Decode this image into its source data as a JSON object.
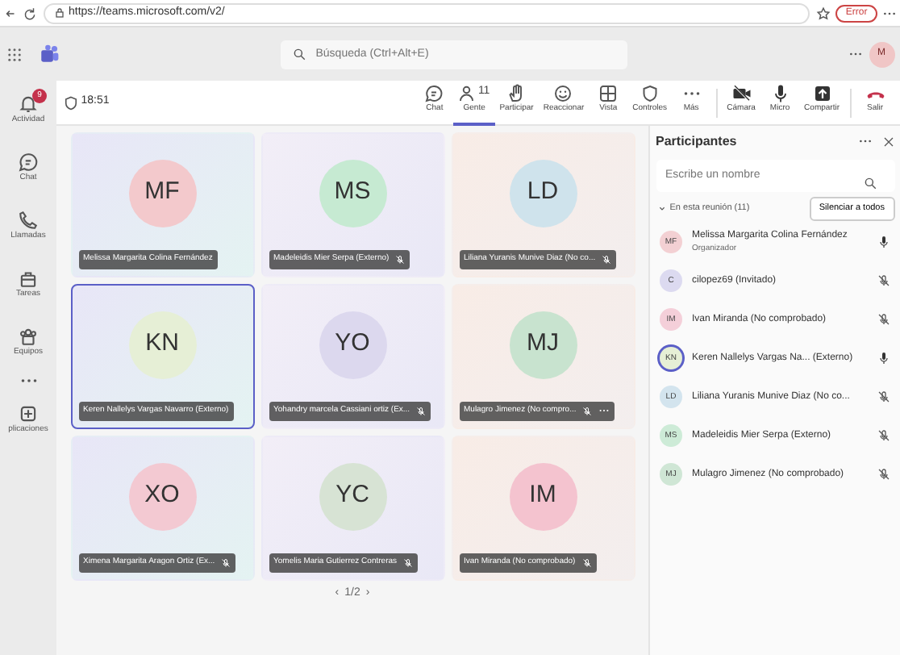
{
  "browser": {
    "url": "https://teams.microsoft.com/v2/",
    "error_label": "Error"
  },
  "header": {
    "search_placeholder": "Búsqueda (Ctrl+Alt+E)",
    "avatar": "M"
  },
  "rail": [
    {
      "label": "Actividad",
      "badge": "9",
      "selected": false
    },
    {
      "label": "Chat",
      "selected": false
    },
    {
      "label": "Llamadas",
      "selected": false
    },
    {
      "label": "Tareas",
      "selected": false
    },
    {
      "label": "Equipos",
      "selected": false
    },
    {
      "label": "plicaciones",
      "selected": false
    }
  ],
  "meeting": {
    "time": "18:51",
    "tools": [
      {
        "kind": "chat",
        "label": "Chat",
        "selected": false
      },
      {
        "kind": "people",
        "label": "Gente",
        "count": "11",
        "selected": true
      },
      {
        "kind": "hand",
        "label": "Participar",
        "selected": false
      },
      {
        "kind": "react",
        "label": "Reaccionar",
        "selected": false
      },
      {
        "kind": "view",
        "label": "Vista",
        "selected": false
      },
      {
        "kind": "shield",
        "label": "Controles",
        "selected": false
      },
      {
        "kind": "more",
        "label": "Más",
        "selected": false
      },
      {
        "kind": "camera",
        "label": "Cámara",
        "selected": false
      },
      {
        "kind": "mic",
        "label": "Micro",
        "selected": false
      },
      {
        "kind": "share",
        "label": "Compartir",
        "selected": false
      },
      {
        "kind": "leave",
        "label": "Salir",
        "selected": false
      }
    ]
  },
  "tiles": [
    {
      "initials": "MF",
      "name": "Melissa Margarita Colina Fernández",
      "muted": false,
      "more": false,
      "speaking": false,
      "color": "#f3c9cc"
    },
    {
      "initials": "MS",
      "name": "Madeleidis Mier Serpa (Externo)",
      "muted": true,
      "more": false,
      "speaking": false,
      "color": "#c6ead2"
    },
    {
      "initials": "LD",
      "name": "Liliana Yuranis Munive Diaz (No co...",
      "muted": true,
      "more": false,
      "speaking": false,
      "color": "#cfe3ec"
    },
    {
      "initials": "KN",
      "name": "Keren Nallelys Vargas Navarro (Externo)",
      "muted": false,
      "more": false,
      "speaking": true,
      "color": "#e6efd6"
    },
    {
      "initials": "YO",
      "name": "Yohandry marcela Cassiani ortiz (Ex...",
      "muted": true,
      "more": false,
      "speaking": false,
      "color": "#dcd8ee"
    },
    {
      "initials": "MJ",
      "name": "Mulagro Jimenez (No compro...",
      "muted": true,
      "more": true,
      "speaking": false,
      "color": "#c8e3cf"
    },
    {
      "initials": "XO",
      "name": "Ximena Margarita Aragon Ortiz (Ex...",
      "muted": true,
      "more": false,
      "speaking": false,
      "color": "#f3c9d2"
    },
    {
      "initials": "YC",
      "name": "Yomelis Maria Gutierrez Contreras",
      "muted": true,
      "more": false,
      "speaking": false,
      "color": "#d7e3d4"
    },
    {
      "initials": "IM",
      "name": "Ivan Miranda (No comprobado)",
      "muted": true,
      "more": false,
      "speaking": false,
      "color": "#f4c3cf"
    }
  ],
  "pager": {
    "prev": "‹",
    "label": "1/2",
    "next": "›"
  },
  "panel": {
    "title": "Participantes",
    "search_placeholder": "Escribe un nombre",
    "section": "En esta reunión (11)",
    "mute_all": "Silenciar a todos",
    "people": [
      {
        "initials": "MF",
        "name": "Melissa Margarita Colina Fernández",
        "role": "Organizador",
        "muted": false,
        "speaking": false,
        "color": "#f3d0d3"
      },
      {
        "initials": "C",
        "name": "cilopez69 (Invitado)",
        "muted": true,
        "speaking": false,
        "color": "#dcdaf0"
      },
      {
        "initials": "IM",
        "name": "Ivan Miranda (No comprobado)",
        "muted": true,
        "speaking": false,
        "color": "#f4cfd9"
      },
      {
        "initials": "KN",
        "name": "Keren Nallelys Vargas Na... (Externo)",
        "muted": false,
        "speaking": true,
        "color": "#e6efd6"
      },
      {
        "initials": "LD",
        "name": "Liliana Yuranis Munive Diaz (No co...",
        "muted": true,
        "speaking": false,
        "color": "#d3e4ee"
      },
      {
        "initials": "MS",
        "name": "Madeleidis Mier Serpa (Externo)",
        "muted": true,
        "speaking": false,
        "color": "#cdebd7"
      },
      {
        "initials": "MJ",
        "name": "Mulagro Jimenez (No comprobado)",
        "muted": true,
        "speaking": false,
        "color": "#cfe6d5"
      }
    ]
  }
}
